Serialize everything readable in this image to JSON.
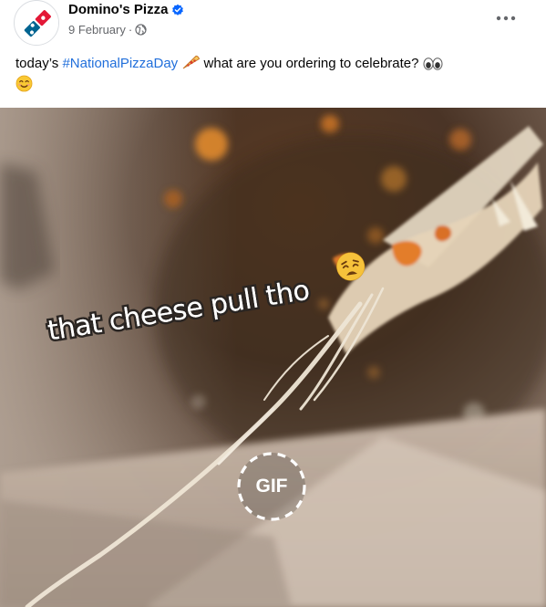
{
  "post": {
    "page_name": "Domino's Pizza",
    "date": "9 February",
    "separator": "·",
    "caption_before": "today’s ",
    "hashtag": "#NationalPizzaDay",
    "caption_after": " what are you ordering to celebrate? ",
    "icons": {
      "verified": "verified-badge-icon",
      "audience": "globe-icon",
      "more": "more-options-icon",
      "pizza": "pizza-emoji",
      "eyes": "eyes-emoji",
      "smile": "smiling-emoji"
    },
    "colors": {
      "hashtag": "#216fdb",
      "verified": "#0866ff",
      "meta": "#65676b"
    }
  },
  "media": {
    "overlay_text": "that cheese pull tho",
    "gif_label": "GIF",
    "overlay_emoji": "weary-face-emoji"
  }
}
